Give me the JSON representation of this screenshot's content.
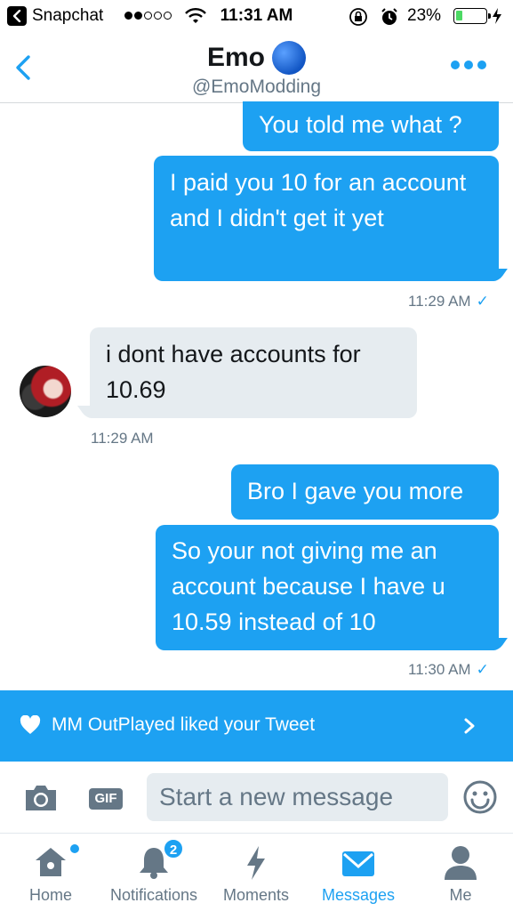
{
  "status_bar": {
    "carrier": "Snapchat",
    "time": "11:31 AM",
    "battery_percent": "23%",
    "battery_level": 0.23,
    "signal_bars_filled": 2,
    "signal_bars_total": 5
  },
  "header": {
    "name": "Emo",
    "handle": "@EmoModding"
  },
  "messages": [
    {
      "direction": "out",
      "text": "You told me what ?"
    },
    {
      "direction": "out",
      "text": "I paid you 10 for an account and I didn't get it yet"
    },
    {
      "direction": "meta",
      "time": "11:29 AM",
      "read": "✓"
    },
    {
      "direction": "in",
      "text": "i dont have accounts for 10.69"
    },
    {
      "direction": "meta",
      "time": "11:29 AM"
    },
    {
      "direction": "out",
      "text": "Bro I gave you more"
    },
    {
      "direction": "out",
      "text": "So your not giving me an account because I have u 10.59 instead of 10"
    },
    {
      "direction": "meta",
      "time": "11:30 AM",
      "read": "✓"
    }
  ],
  "notification": {
    "text": "MM OutPlayed liked your Tweet",
    "icon": "heart-icon"
  },
  "composer": {
    "gif_label": "GIF",
    "placeholder": "Start a new message"
  },
  "tabs": [
    {
      "label": "Home",
      "icon": "home-icon",
      "has_dot": true
    },
    {
      "label": "Notifications",
      "icon": "bell-icon",
      "badge": "2"
    },
    {
      "label": "Moments",
      "icon": "lightning-icon"
    },
    {
      "label": "Messages",
      "icon": "envelope-icon",
      "active": true
    },
    {
      "label": "Me",
      "icon": "person-icon"
    }
  ],
  "colors": {
    "accent": "#1da1f2",
    "incoming_bubble": "#e6ecf0",
    "secondary_text": "#657786"
  }
}
